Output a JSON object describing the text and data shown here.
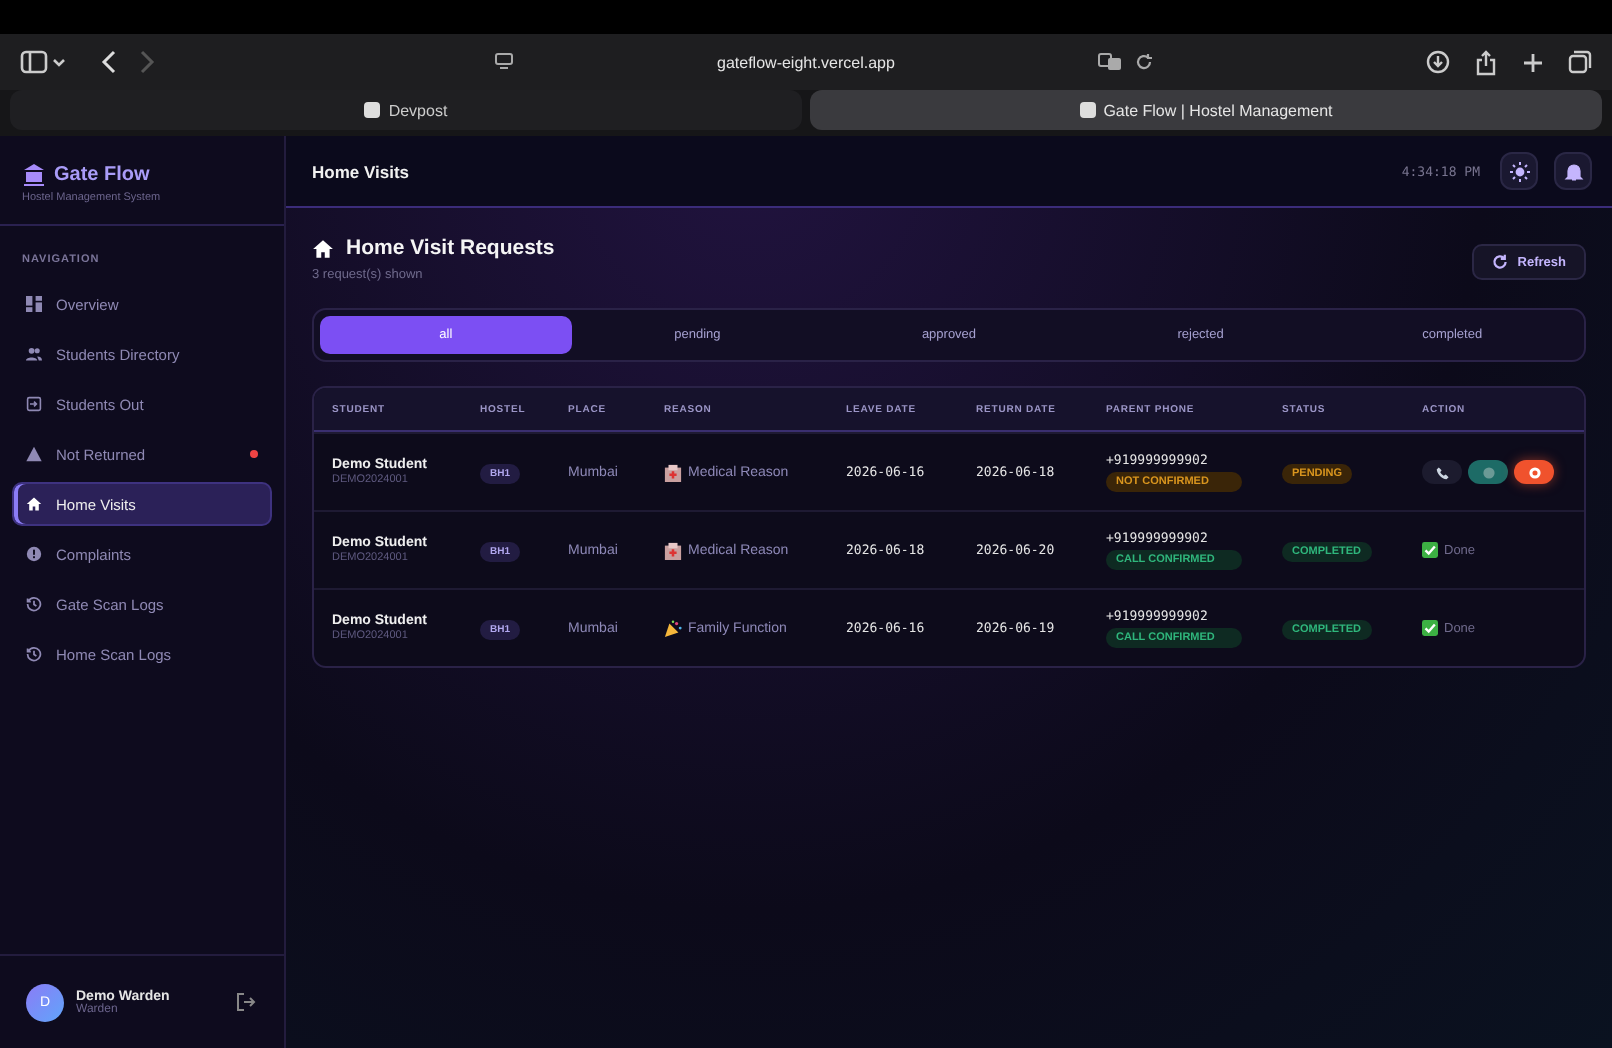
{
  "browser": {
    "url": "gateflow-eight.vercel.app",
    "tabs": [
      {
        "label": "Devpost",
        "selected": false
      },
      {
        "label": "Gate Flow | Hostel Management",
        "selected": true
      }
    ]
  },
  "sidebar": {
    "brand": "Gate Flow",
    "subtitle": "Hostel Management System",
    "section": "NAVIGATION",
    "items": [
      {
        "label": "Overview",
        "selected": false,
        "alert": false
      },
      {
        "label": "Students Directory",
        "selected": false,
        "alert": false
      },
      {
        "label": "Students Out",
        "selected": false,
        "alert": false
      },
      {
        "label": "Not Returned",
        "selected": false,
        "alert": true
      },
      {
        "label": "Home Visits",
        "selected": true,
        "alert": false
      },
      {
        "label": "Complaints",
        "selected": false,
        "alert": false
      },
      {
        "label": "Gate Scan Logs",
        "selected": false,
        "alert": false
      },
      {
        "label": "Home Scan Logs",
        "selected": false,
        "alert": false
      }
    ],
    "user": {
      "initial": "D",
      "name": "Demo Warden",
      "role": "Warden"
    }
  },
  "header": {
    "title": "Home Visits",
    "time": "4:34:18 PM"
  },
  "page": {
    "title": "Home Visit Requests",
    "count": "3 request(s) shown",
    "refresh": "Refresh"
  },
  "filters": [
    {
      "label": "all",
      "selected": true
    },
    {
      "label": "pending",
      "selected": false
    },
    {
      "label": "approved",
      "selected": false
    },
    {
      "label": "rejected",
      "selected": false
    },
    {
      "label": "completed",
      "selected": false
    }
  ],
  "table": {
    "columns": [
      "STUDENT",
      "HOSTEL",
      "PLACE",
      "REASON",
      "LEAVE DATE",
      "RETURN DATE",
      "PARENT PHONE",
      "STATUS",
      "ACTION"
    ],
    "rows": [
      {
        "name": "Demo Student",
        "id": "DEMO2024001",
        "hostel": "BH1",
        "place": "Mumbai",
        "reason": {
          "kind": "medical",
          "text": "Medical Reason"
        },
        "leave": "2026-06-16",
        "return": "2026-06-18",
        "phone": "+919999999902",
        "call": {
          "kind": "warn",
          "text": "NOT CONFIRMED"
        },
        "status": {
          "kind": "warn",
          "text": "PENDING"
        },
        "action": {
          "kind": "buttons"
        }
      },
      {
        "name": "Demo Student",
        "id": "DEMO2024001",
        "hostel": "BH1",
        "place": "Mumbai",
        "reason": {
          "kind": "medical",
          "text": "Medical Reason"
        },
        "leave": "2026-06-18",
        "return": "2026-06-20",
        "phone": "+919999999902",
        "call": {
          "kind": "ok",
          "text": "CALL CONFIRMED"
        },
        "status": {
          "kind": "ok",
          "text": "COMPLETED"
        },
        "action": {
          "kind": "done",
          "text": "Done"
        }
      },
      {
        "name": "Demo Student",
        "id": "DEMO2024001",
        "hostel": "BH1",
        "place": "Mumbai",
        "reason": {
          "kind": "party",
          "text": "Family Function"
        },
        "leave": "2026-06-16",
        "return": "2026-06-19",
        "phone": "+919999999902",
        "call": {
          "kind": "ok",
          "text": "CALL CONFIRMED"
        },
        "status": {
          "kind": "ok",
          "text": "COMPLETED"
        },
        "action": {
          "kind": "done",
          "text": "Done"
        }
      }
    ]
  }
}
